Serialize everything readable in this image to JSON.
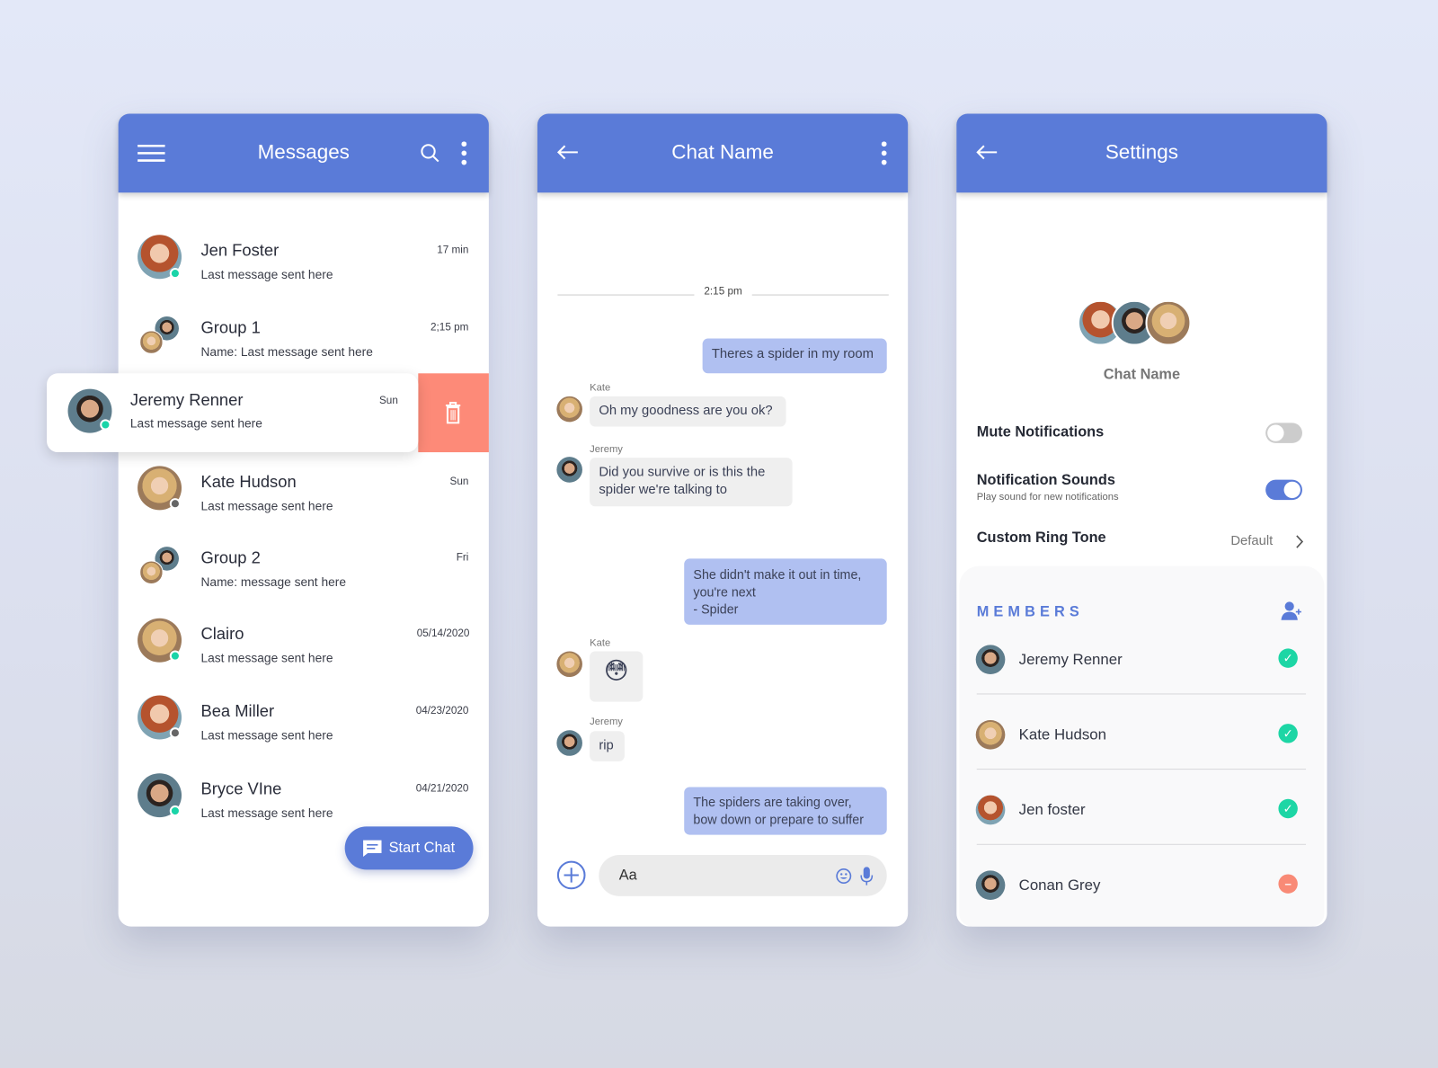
{
  "colors": {
    "brand": "#5a7bd8",
    "online": "#1ad4a8",
    "offline": "#666666",
    "delete": "#fd8a78",
    "outgoing_bubble": "#b0c0f1",
    "incoming_bubble": "#efefef"
  },
  "messages": {
    "title": "Messages",
    "icons": [
      "menu-icon",
      "search-icon",
      "more-vertical-icon"
    ],
    "conversations": [
      {
        "name": "Jen Foster",
        "preview": "Last message sent here",
        "time": "17 min",
        "status": "online"
      },
      {
        "name": "Group 1",
        "preview": "Name: Last message sent here",
        "time": "2;15 pm"
      },
      {
        "name": "Jeremy Renner",
        "preview": "Last message sent here",
        "time": "Sun",
        "status": "online",
        "swiped": true
      },
      {
        "name": "Kate Hudson",
        "preview": "Last message sent here",
        "time": "Sun",
        "status": "offline"
      },
      {
        "name": "Group 2",
        "preview": "Name: message sent here",
        "time": "Fri"
      },
      {
        "name": "Clairo",
        "preview": "Last message sent here",
        "time": "05/14/2020",
        "status": "online"
      },
      {
        "name": "Bea Miller",
        "preview": "Last message sent here",
        "time": "04/23/2020",
        "status": "offline"
      },
      {
        "name": "Bryce VIne",
        "preview": "Last message sent here",
        "time": "04/21/2020",
        "status": "online"
      }
    ],
    "start_chat": "Start Chat"
  },
  "chat": {
    "title": "Chat Name",
    "timestamp": "2:15 pm",
    "messages": [
      {
        "from": "me",
        "text": "Theres a spider in my room"
      },
      {
        "from": "Kate",
        "text": "Oh my goodness are you ok?"
      },
      {
        "from": "Jeremy",
        "text": "Did you survive or is this the spider we're talking to"
      },
      {
        "from": "me",
        "text": "She didn't make it out in time, you're next\n- Spider"
      },
      {
        "from": "Kate",
        "text": "😳"
      },
      {
        "from": "Jeremy",
        "text": "rip"
      },
      {
        "from": "me",
        "text": "The spiders are taking over, bow down or prepare to suffer"
      }
    ],
    "input_placeholder": "Aa"
  },
  "settings": {
    "title": "Settings",
    "chat_name": "Chat Name",
    "mute": {
      "label": "Mute Notifications",
      "on": false
    },
    "sounds": {
      "label": "Notification Sounds",
      "sub": "Play sound for new notifications",
      "on": true
    },
    "ringtone": {
      "label": "Custom Ring Tone",
      "value": "Default"
    },
    "members_heading": "MEMBERS",
    "members": [
      {
        "name": "Jeremy Renner",
        "status": "added"
      },
      {
        "name": "Kate Hudson",
        "status": "added"
      },
      {
        "name": "Jen foster",
        "status": "added"
      },
      {
        "name": "Conan Grey",
        "status": "remove"
      }
    ]
  }
}
